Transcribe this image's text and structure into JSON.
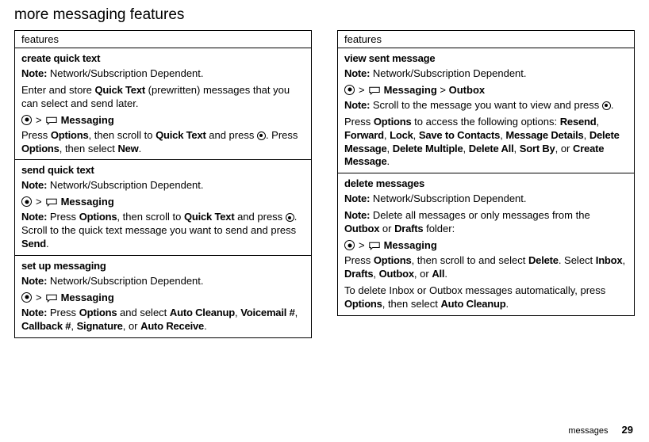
{
  "pageTitle": "more messaging features",
  "header": "features",
  "left": {
    "s1": {
      "title": "create quick text",
      "note": "Network/Subscription Dependent.",
      "line1a": "Enter and store ",
      "line1b": "Quick Text",
      "line1c": " (prewritten) messages that you can select and send later.",
      "navLabel": "Messaging",
      "line2a": "Press ",
      "line2b": "Options",
      "line2c": ", then scroll to ",
      "line2d": "Quick Text",
      "line2e": " and press ",
      "line2f": ". Press ",
      "line2g": "Options",
      "line2h": ", then select ",
      "line2i": "New",
      "line2j": "."
    },
    "s2": {
      "title": "send quick text",
      "note": "Network/Subscription Dependent.",
      "navLabel": "Messaging",
      "line1a": "Note:",
      "line1b": " Press ",
      "line1c": "Options",
      "line1d": ", then scroll to ",
      "line1e": "Quick Text",
      "line1f": " and press ",
      "line1g": ". Scroll to the quick text message you want to send and press ",
      "line1h": "Send",
      "line1i": "."
    },
    "s3": {
      "title": "set up messaging",
      "note": "Network/Subscription Dependent.",
      "navLabel": "Messaging",
      "line1a": "Note:",
      "line1b": " Press ",
      "line1c": "Options",
      "line1d": " and select ",
      "line1e": "Auto Cleanup",
      "line1f": "Voicemail #",
      "line1g": "Callback #",
      "line1h": "Signature",
      "line1i": "Auto Receive"
    }
  },
  "right": {
    "s1": {
      "title": "view sent message",
      "note": "Network/Subscription Dependent.",
      "navLabel": "Messaging",
      "navExtra": "Outbox",
      "line1a": "Note:",
      "line1b": " Scroll to the message you want to view and press ",
      "line2a": "Press ",
      "line2b": "Options",
      "line2c": " to access the following options: ",
      "opts": {
        "o1": "Resend",
        "o2": "Forward",
        "o3": "Lock",
        "o4": "Save to Contacts",
        "o5": "Message Details",
        "o6": "Delete Message",
        "o7": "Delete Multiple",
        "o8": "Delete All",
        "o9": "Sort By",
        "o10": "Create Message"
      }
    },
    "s2": {
      "title": "delete messages",
      "note": "Network/Subscription Dependent.",
      "line1a": "Note:",
      "line1b": " Delete all messages or only messages from the ",
      "line1c": "Outbox",
      "line1d": " or ",
      "line1e": "Drafts",
      "line1f": " folder:",
      "navLabel": "Messaging",
      "line2a": "Press ",
      "line2b": "Options",
      "line2c": ", then scroll to and select ",
      "line2d": "Delete",
      "line2e": ". Select ",
      "line2f": "Inbox",
      "line2g": "Drafts",
      "line2h": "Outbox",
      "line2i": "All",
      "line3a": "To delete Inbox or Outbox messages automatically, press ",
      "line3b": "Options",
      "line3c": ", then select ",
      "line3d": "Auto Cleanup",
      "line3e": "."
    }
  },
  "footer": {
    "label": "messages",
    "page": "29"
  }
}
